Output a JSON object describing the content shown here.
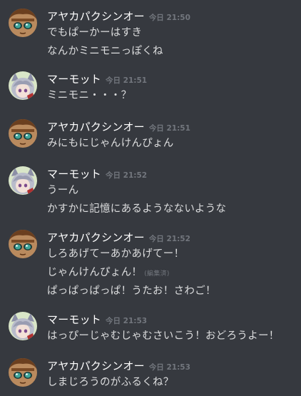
{
  "users": {
    "ayaka": "アヤカパクシンオー",
    "marmot": "マーモット"
  },
  "groups": [
    {
      "user": "アヤカパクシンオー",
      "time": "今日 21:50",
      "avatar": "brown-hair-girl-avatar",
      "lines": [
        {
          "text": "でもぱーかーはすき"
        },
        {
          "text": "なんかミニモニっぽくね"
        }
      ]
    },
    {
      "user": "マーモット",
      "time": "今日 21:51",
      "avatar": "silver-hair-catgirl-avatar",
      "lines": [
        {
          "text": "ミニモニ・・・？"
        }
      ]
    },
    {
      "user": "アヤカパクシンオー",
      "time": "今日 21:51",
      "avatar": "brown-hair-girl-avatar",
      "lines": [
        {
          "text": "みにもにじゃんけんぴょん"
        }
      ]
    },
    {
      "user": "マーモット",
      "time": "今日 21:52",
      "avatar": "silver-hair-catgirl-avatar",
      "lines": [
        {
          "text": "うーん"
        },
        {
          "text": "かすかに記憶にあるようなないような"
        }
      ]
    },
    {
      "user": "アヤカパクシンオー",
      "time": "今日 21:52",
      "avatar": "brown-hair-girl-avatar",
      "lines": [
        {
          "text": "しろあげてーあかあげてー！"
        },
        {
          "text": "じゃんけんぴょん！",
          "edited": "(編集済)"
        },
        {
          "text": "ぱっぱっぱっぱ！うたお！さわご！"
        }
      ]
    },
    {
      "user": "マーモット",
      "time": "今日 21:53",
      "avatar": "silver-hair-catgirl-avatar",
      "lines": [
        {
          "text": "はっぴーじゃむじゃむさいこう！おどろうよー！"
        }
      ]
    },
    {
      "user": "アヤカパクシンオー",
      "time": "今日 21:53",
      "avatar": "brown-hair-girl-avatar",
      "lines": [
        {
          "text": "しまじろうのがふるくね？"
        }
      ]
    }
  ]
}
